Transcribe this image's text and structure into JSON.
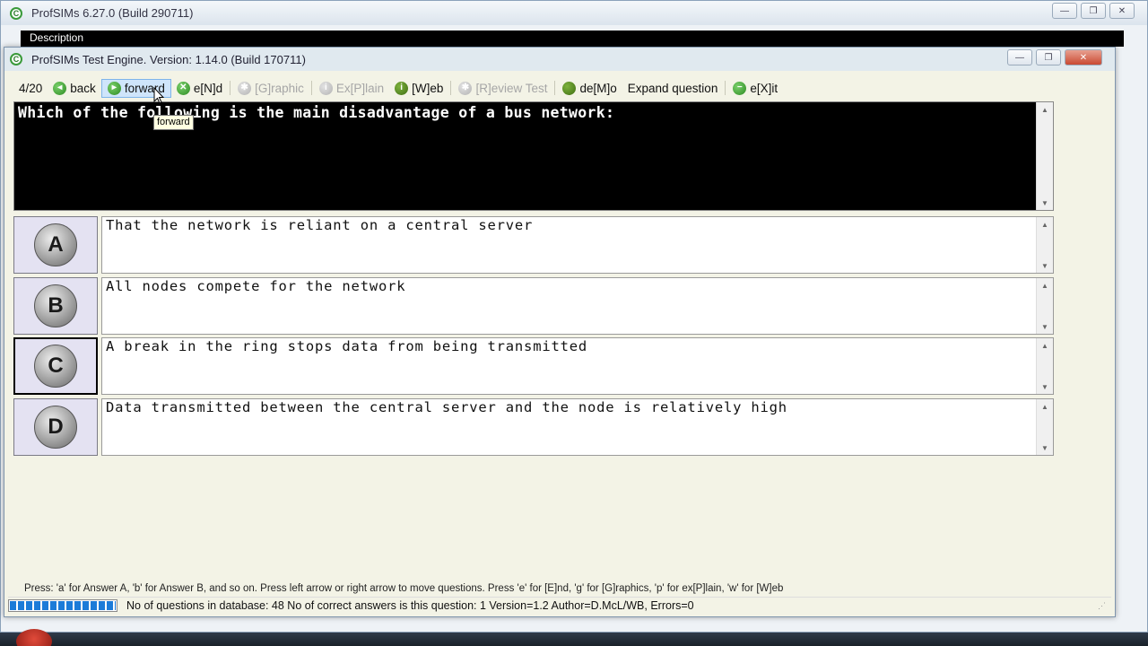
{
  "outer_window": {
    "title": "ProfSIMs 6.27.0 (Build 290711)",
    "description_label": "Description",
    "controls": {
      "minimize": "—",
      "maximize": "❐",
      "close": "✕"
    }
  },
  "main_window": {
    "title": "ProfSIMs Test Engine. Version: 1.14.0 (Build 170711)",
    "controls": {
      "minimize": "—",
      "maximize": "❐",
      "close": "✕"
    }
  },
  "toolbar": {
    "counter": "4/20",
    "back": "back",
    "forward": "forward",
    "end": "e[N]d",
    "graphic": "[G]raphic",
    "explain": "Ex[P]lain",
    "web": "[W]eb",
    "review": "[R]eview Test",
    "demo": "de[M]o",
    "expand": "Expand question",
    "exit": "e[X]it"
  },
  "tooltip": "forward",
  "question": "Which of the following is the main disadvantage of a bus network:",
  "answers": [
    {
      "letter": "A",
      "text": "That the network is reliant on a central server"
    },
    {
      "letter": "B",
      "text": "All nodes compete for the network"
    },
    {
      "letter": "C",
      "text": "A break in the ring stops data from being transmitted"
    },
    {
      "letter": "D",
      "text": "Data transmitted between the central server and the node is relatively high"
    }
  ],
  "help_text": "Press: 'a' for Answer A, 'b' for Answer B, and so on. Press left arrow or right arrow to move questions. Press 'e' for [E]nd, 'g' for [G]raphics, 'p' for ex[P]lain, 'w' for [W]eb",
  "status": {
    "text": "No of questions in database: 48   No of correct answers is this question: 1   Version=1.2   Author=D.McL/WB, Errors=0"
  },
  "colors": {
    "question_bg": "#000000",
    "question_fg": "#ffffff",
    "dialog_bg": "#f3f3e6",
    "label_bg": "#e4e2f2",
    "progress": "#1c7bd8"
  }
}
